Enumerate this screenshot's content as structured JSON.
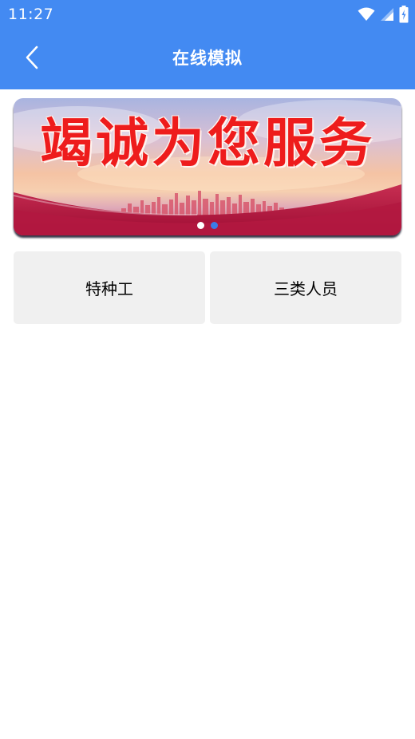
{
  "status_bar": {
    "time": "11:27",
    "icons": [
      "wifi-icon",
      "signal-icon",
      "battery-icon"
    ]
  },
  "app_bar": {
    "title": "在线模拟",
    "back_icon": "chevron-left-icon"
  },
  "banner": {
    "slogan": "竭诚为您服务",
    "slide_count": 2,
    "active_slide": 1
  },
  "categories": [
    {
      "label": "特种工"
    },
    {
      "label": "三类人员"
    }
  ],
  "colors": {
    "primary": "#438af2",
    "banner_text": "#ee1c1c",
    "card_bg": "#f0f0f0",
    "dot_active": "#3a7ce8"
  }
}
